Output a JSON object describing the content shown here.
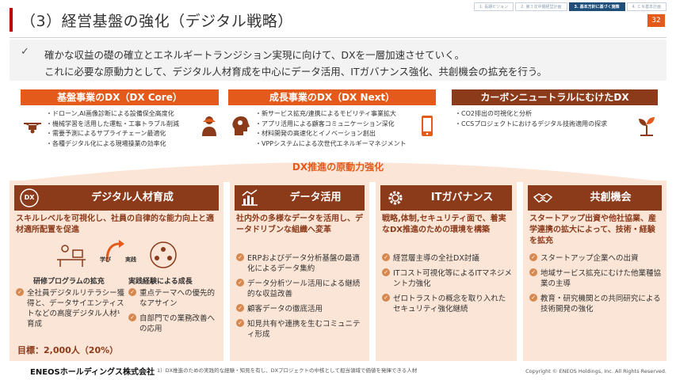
{
  "title": "（3）経営基盤の強化（デジタル戦略）",
  "page_number": "32",
  "steps": [
    {
      "label": "1. 長期ビジョン"
    },
    {
      "label": "2. 第３次中期経営計画"
    },
    {
      "label": "3. 基本方針に基づく施策"
    },
    {
      "label": "4. ＣＮ基本計画"
    }
  ],
  "summary": {
    "line1": "確かな収益の礎の確立とエネルギートランジション実現に向けて、DXを一層加速させていく。",
    "line2": "これに必要な原動力として、デジタル人材育成を中心にデータ活用、ITガバナンス強化、共創機会の拡充を行う。"
  },
  "top_boxes": [
    {
      "title": "基盤事業のDX（DX Core）",
      "items": [
        "ドローン,AI画像診断による設備保全高度化",
        "機械学習を活用した運転・工事トラブル削減",
        "需要予測によるサプライチェーン最適化",
        "各種デジタル化による現場操業の効率化"
      ]
    },
    {
      "title": "成長事業のDX（DX Next）",
      "items": [
        "新サービス拡充/連携によるモビリティ事業拡大",
        "アプリ活用による顧客コミュニケーション深化",
        "材料開発の高速化とイノベーション創出",
        "VPPシステムによる次世代エネルギーマネジメント"
      ]
    },
    {
      "title": "カーボンニュートラルにむけたDX",
      "items": [
        "CO2排出の可視化と分析",
        "CCSプロジェクトにおけるデジタル技術適用の探求"
      ]
    }
  ],
  "arch_label": "DX推進の原動力強化",
  "pillars": [
    {
      "title": "デジタル人材育成",
      "icon_text": "DX",
      "lead": "スキルレベルを可視化し、社員の自律的な能力向上と適材適所配置を促進",
      "learn_label": "学び",
      "practice_label": "実践",
      "sub_left_title": "研修プログラムの拡充",
      "sub_right_title": "実践経験による成長",
      "left_item": "全社員デジタルリテラシー獲得と、データサイエンティストなどの高度デジタル人材¹育成",
      "right_items": [
        "重点テーマへの優先的なアサイン",
        "自部門での業務改善への応用"
      ],
      "goal": "目標：2,000人（20%）"
    },
    {
      "title": "データ活用",
      "lead": "社内外の多様なデータを活用し、データドリブンな組織へ変革",
      "items": [
        "ERPおよびデータ分析基盤の最適化によるデータ集約",
        "データ分析ツール活用による継続的な収益改善",
        "顧客データの徹底活用",
        "知見共有や連携を生むコミュニティ形成"
      ]
    },
    {
      "title": "ITガバナンス",
      "lead": "戦略,体制,セキュリティ面で、着実なDX推進のための環境を構築",
      "items": [
        "経営層主導の全社DX討議",
        "ITコスト可視化等によるITマネジメント力強化",
        "ゼロトラストの概念を取り入れたセキュリティ強化継続"
      ]
    },
    {
      "title": "共創機会",
      "lead": "スタートアップ出資や他社協業、産学連携の拡大によって、技術・経験を拡充",
      "items": [
        "スタートアップ企業への出資",
        "地域サービス拡充にむけた他業種協業の主導",
        "教育・研究機関との共同研究による技術開発の強化"
      ]
    }
  ],
  "footer": {
    "logo": "ENEOSホールディングス株式会社",
    "footnote": "1）DX推進のための実践的な経験・知見を有し、DXプロジェクトの中核として担当領域で価値を発揮できる人材",
    "copyright": "Copyright © ENEOS Holdings, Inc. All Rights Reserved."
  },
  "colors": {
    "accent_orange": "#e35a1b",
    "dark_brown": "#8b3a1a",
    "pillar_bg": "#fbe5d6",
    "title_bar": "#c00000",
    "step_active": "#1f4e79"
  }
}
